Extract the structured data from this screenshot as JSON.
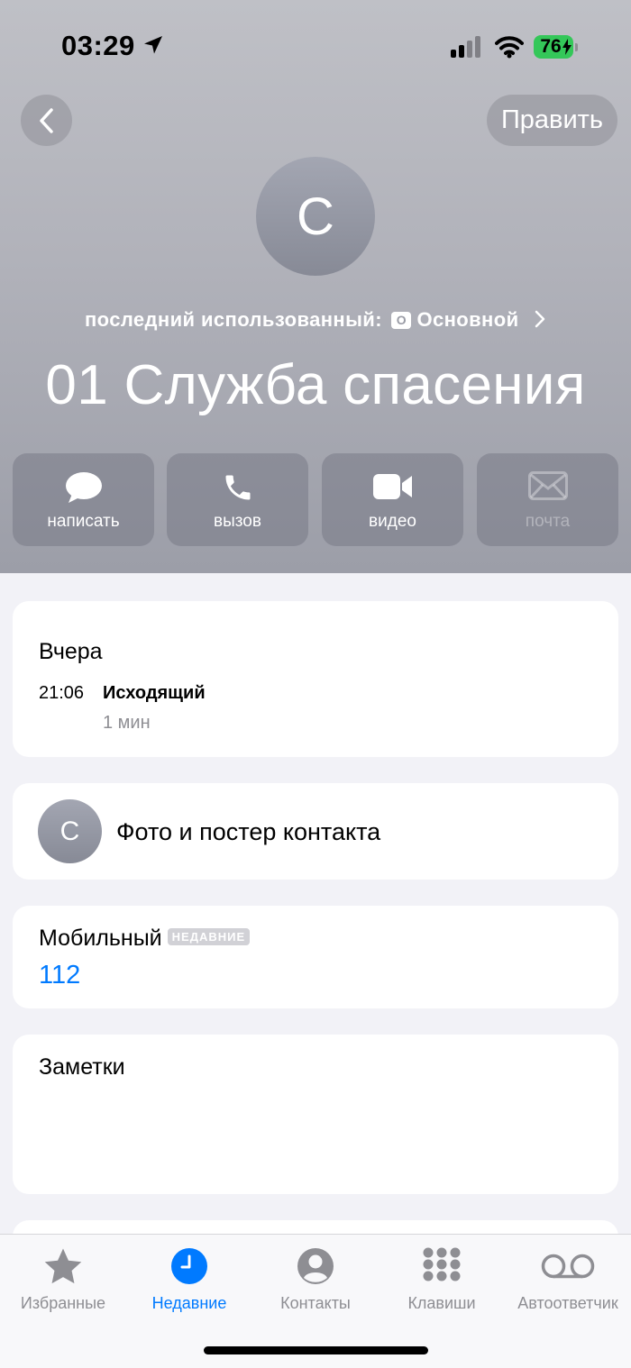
{
  "status_bar": {
    "time": "03:29",
    "battery": "76",
    "icons": [
      "location-arrow-icon",
      "signal-icon",
      "wifi-icon",
      "battery-icon"
    ]
  },
  "nav": {
    "back_icon": "chevron-left-icon",
    "edit_label": "Править"
  },
  "contact": {
    "initial": "С",
    "last_used_label": "последний использованный:",
    "sim_badge": "О",
    "sim_name": "Основной",
    "name": "01 Служба спасения"
  },
  "actions": [
    {
      "label": "написать",
      "icon": "message-bubble-icon",
      "enabled": true
    },
    {
      "label": "вызов",
      "icon": "phone-icon",
      "enabled": true
    },
    {
      "label": "видео",
      "icon": "video-camera-icon",
      "enabled": true
    },
    {
      "label": "почта",
      "icon": "envelope-icon",
      "enabled": false
    }
  ],
  "recent_call": {
    "day": "Вчера",
    "time": "21:06",
    "type": "Исходящий",
    "duration": "1 мин"
  },
  "photo_row": {
    "initial": "С",
    "label": "Фото и постер контакта"
  },
  "phone": {
    "label": "Мобильный",
    "badge": "НЕДАВНИЕ",
    "number": "112"
  },
  "notes": {
    "label": "Заметки"
  },
  "tabs": [
    {
      "label": "Избранные",
      "icon": "star-icon",
      "active": false
    },
    {
      "label": "Недавние",
      "icon": "clock-icon",
      "active": true
    },
    {
      "label": "Контакты",
      "icon": "person-circle-icon",
      "active": false
    },
    {
      "label": "Клавиши",
      "icon": "keypad-icon",
      "active": false
    },
    {
      "label": "Автоответчик",
      "icon": "voicemail-icon",
      "active": false
    }
  ],
  "colors": {
    "accent": "#007aff",
    "battery": "#34c759",
    "header_bg": "#b1b2ba",
    "secondary_text": "#8e8e93"
  }
}
